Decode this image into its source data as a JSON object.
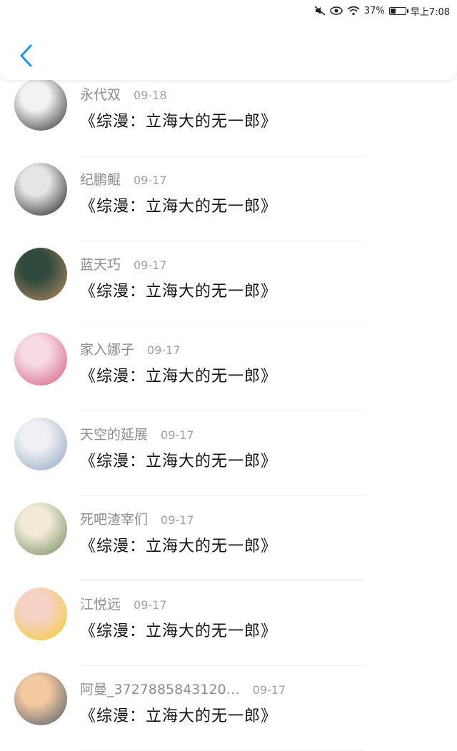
{
  "status_bar": {
    "battery_percent": "37%",
    "battery_level": 0.37,
    "time": "早上7:08",
    "icons": [
      "mute-icon",
      "eye-icon",
      "wifi-icon",
      "battery-icon"
    ]
  },
  "header": {
    "back_icon": "chevron-left-icon",
    "accent_color": "#1E96F0"
  },
  "comments": [
    {
      "name": "永代双",
      "date": "09-18",
      "title": "《综漫：立海大的无一郎》",
      "avatar_colors": [
        "#f2f2f2",
        "#2a2a2a"
      ]
    },
    {
      "name": "纪鹏鲲",
      "date": "09-17",
      "title": "《综漫：立海大的无一郎》",
      "avatar_colors": [
        "#e5e5e5",
        "#1e1e1e"
      ]
    },
    {
      "name": "蓝天巧",
      "date": "09-17",
      "title": "《综漫：立海大的无一郎》",
      "avatar_colors": [
        "#2f4a3c",
        "#b88a60"
      ]
    },
    {
      "name": "家入娜子",
      "date": "09-17",
      "title": "《综漫：立海大的无一郎》",
      "avatar_colors": [
        "#f6d9e2",
        "#d45a7c"
      ]
    },
    {
      "name": "天空的延展",
      "date": "09-17",
      "title": "《综漫：立海大的无一郎》",
      "avatar_colors": [
        "#eef0f4",
        "#8fa4bf"
      ]
    },
    {
      "name": "死吧渣宰们",
      "date": "09-17",
      "title": "《综漫：立海大的无一郎》",
      "avatar_colors": [
        "#f3ead8",
        "#6c8a5a"
      ]
    },
    {
      "name": "江悦远",
      "date": "09-17",
      "title": "《综漫：立海大的无一郎》",
      "avatar_colors": [
        "#f7d2c6",
        "#f0cc33"
      ]
    },
    {
      "name": "阿曼_3727885843120…",
      "date": "09-17",
      "title": "《综漫：立海大的无一郎》",
      "avatar_colors": [
        "#f3c9a0",
        "#4c5a6e"
      ]
    }
  ]
}
